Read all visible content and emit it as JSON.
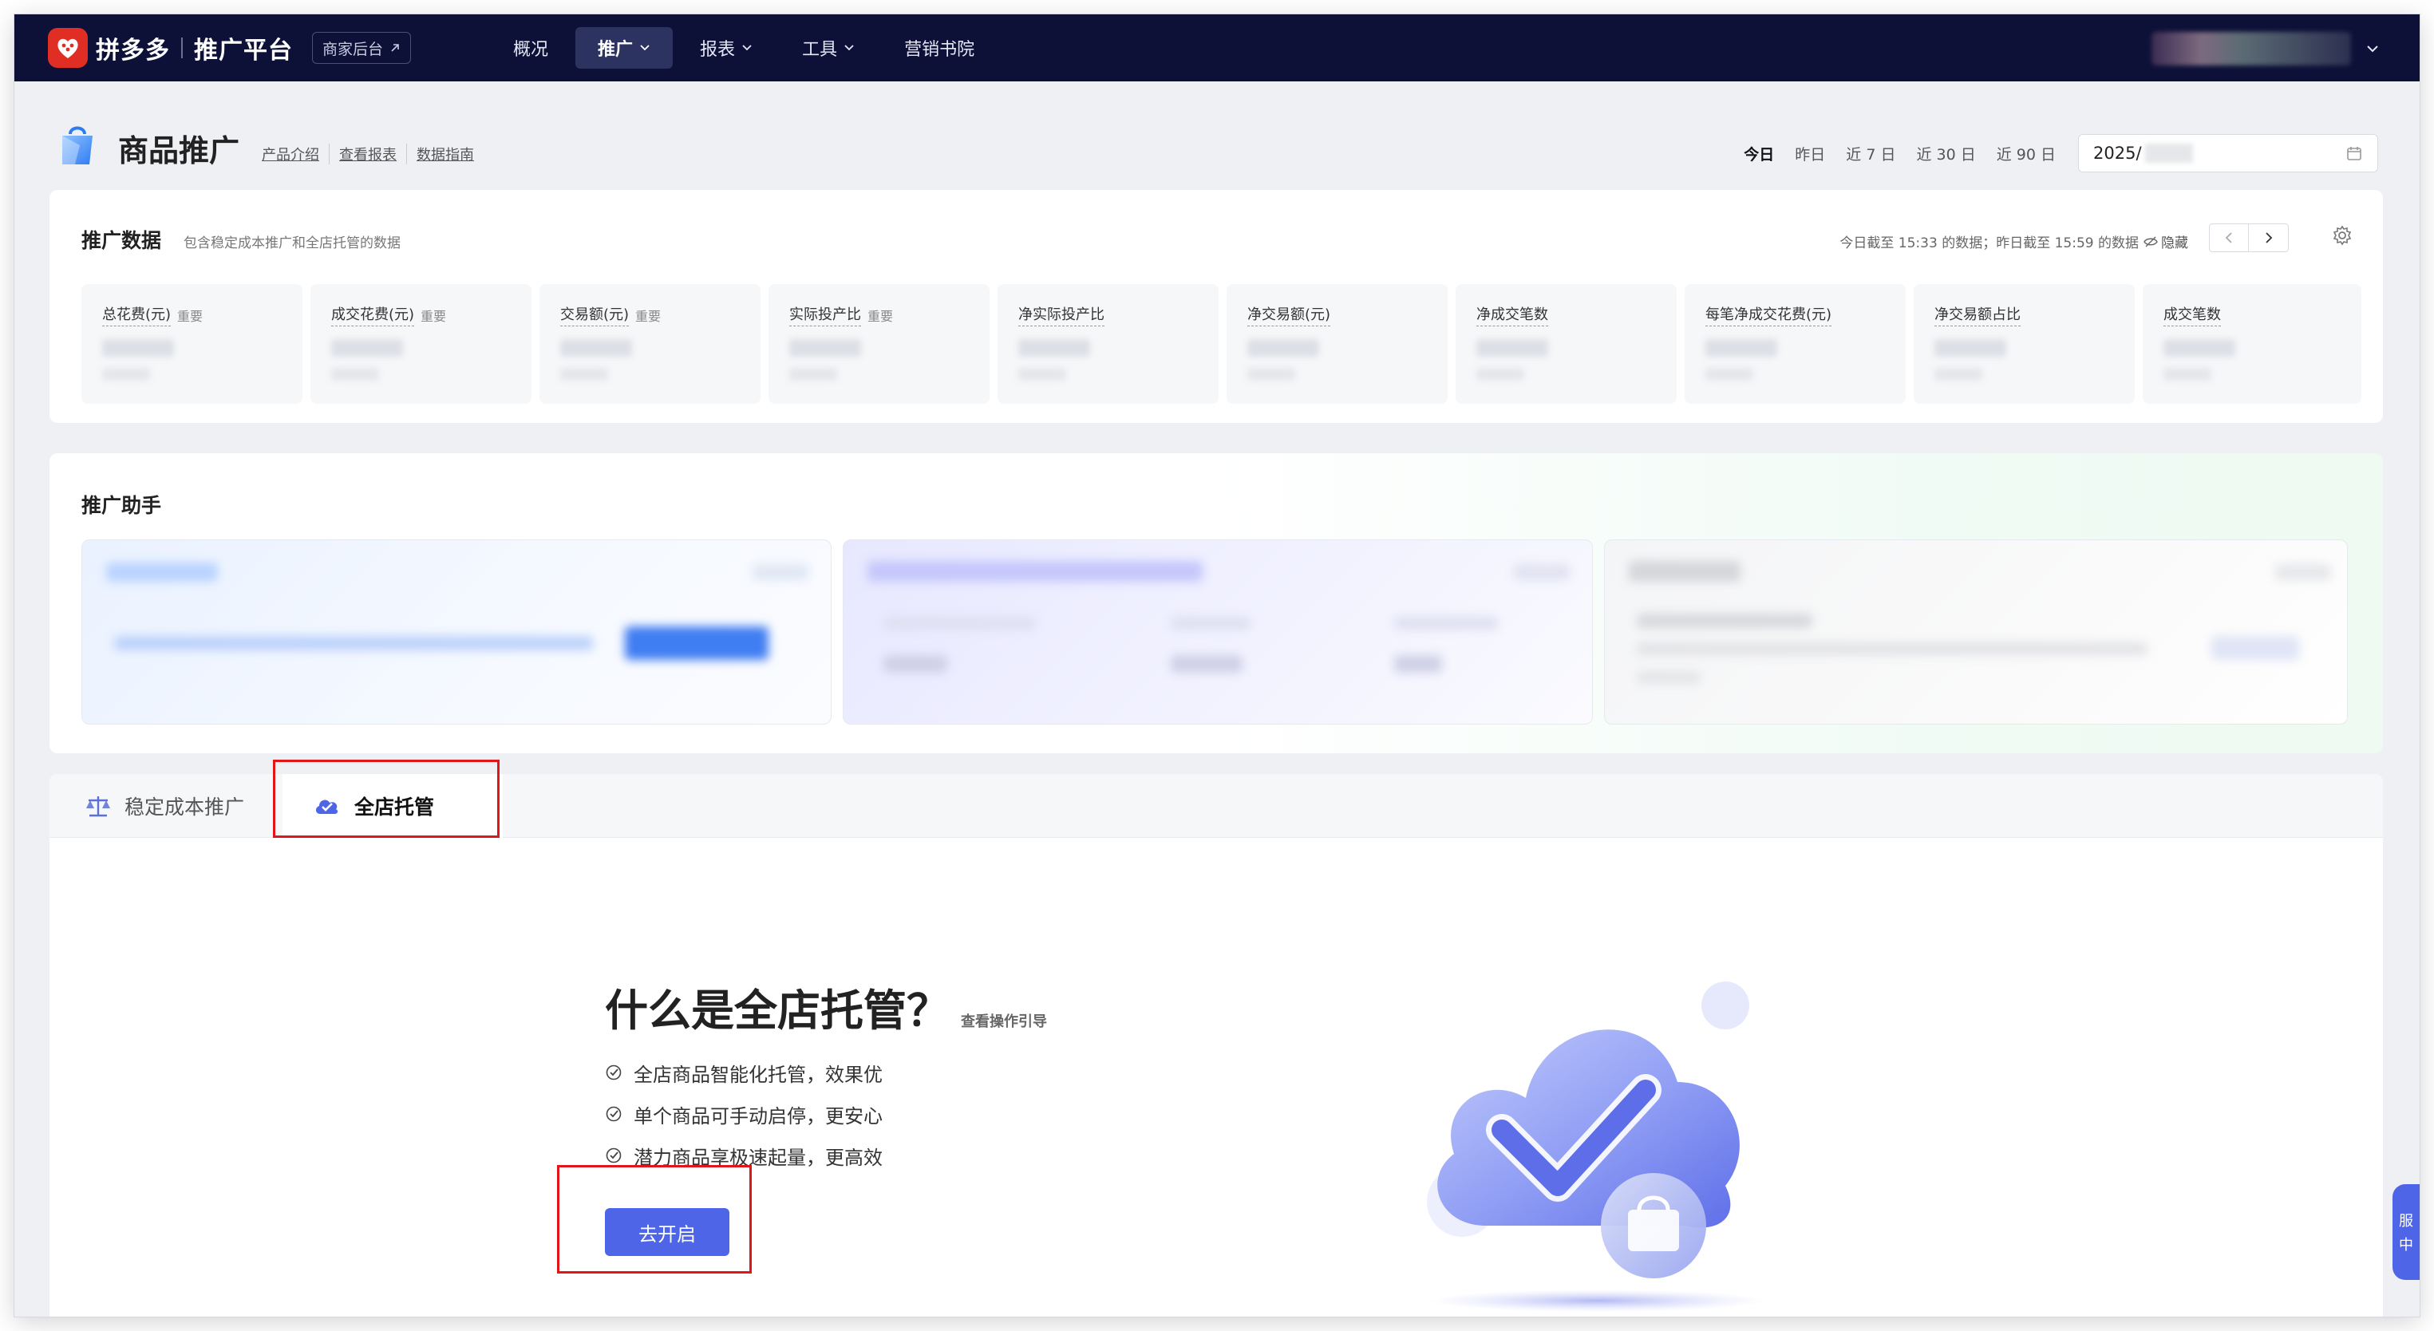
{
  "nav": {
    "logo_text": "拼多多",
    "logo_sub": "推广平台",
    "merchant_link": "商家后台",
    "items": [
      {
        "label": "概况",
        "has_dropdown": false,
        "active": false
      },
      {
        "label": "推广",
        "has_dropdown": true,
        "active": true
      },
      {
        "label": "报表",
        "has_dropdown": true,
        "active": false
      },
      {
        "label": "工具",
        "has_dropdown": true,
        "active": false
      },
      {
        "label": "营销书院",
        "has_dropdown": false,
        "active": false
      }
    ]
  },
  "header": {
    "title": "商品推广",
    "links": [
      "产品介绍",
      "查看报表",
      "数据指南"
    ],
    "ranges": [
      "今日",
      "昨日",
      "近 7 日",
      "近 30 日",
      "近 90 日"
    ],
    "active_range": "今日",
    "date_value": "2025/"
  },
  "data_section": {
    "title": "推广数据",
    "subtitle": "包含稳定成本推广和全店托管的数据",
    "time_note": "今日截至 15:33 的数据；昨日截至 15:59 的数据",
    "hide_label": "隐藏",
    "metrics": [
      {
        "label": "总花费(元)",
        "tag": "重要"
      },
      {
        "label": "成交花费(元)",
        "tag": "重要"
      },
      {
        "label": "交易额(元)",
        "tag": "重要"
      },
      {
        "label": "实际投产比",
        "tag": "重要"
      },
      {
        "label": "净实际投产比",
        "tag": ""
      },
      {
        "label": "净交易额(元)",
        "tag": ""
      },
      {
        "label": "净成交笔数",
        "tag": ""
      },
      {
        "label": "每笔净成交花费(元)",
        "tag": ""
      },
      {
        "label": "净交易额占比",
        "tag": ""
      },
      {
        "label": "成交笔数",
        "tag": ""
      }
    ]
  },
  "assistant": {
    "title": "推广助手"
  },
  "tabs": [
    {
      "label": "稳定成本推广",
      "icon": "scale-icon",
      "active": false
    },
    {
      "label": "全店托管",
      "icon": "cloud-check-icon",
      "active": true
    }
  ],
  "intro": {
    "title": "什么是全店托管？",
    "guide_link": "查看操作引导",
    "features": [
      "全店商品智能化托管，效果优",
      "单个商品可手动启停，更安心",
      "潜力商品享极速起量，更高效"
    ],
    "button": "去开启"
  },
  "float_widget": {
    "lines": [
      "服",
      "中"
    ]
  },
  "colors": {
    "nav_bg": "#0d1138",
    "primary": "#4f65e8",
    "highlight_box": "#e0161b",
    "logo_red": "#e02e24"
  }
}
